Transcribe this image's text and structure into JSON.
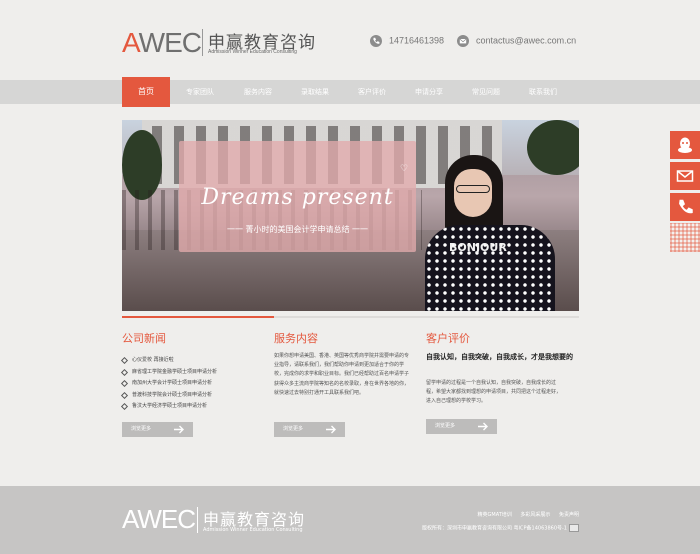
{
  "header": {
    "logo_text": "AWEC",
    "logo_first": "A",
    "logo_rest": "WEC",
    "logo_cn": "申赢教育咨询",
    "logo_en": "Admission Winner Education Consulting",
    "phone": "14716461398",
    "email": "contactus@awec.com.cn",
    "phone_icon": "phone-icon",
    "email_icon": "mail-icon"
  },
  "nav": {
    "items": [
      "首页",
      "专家团队",
      "服务内容",
      "录取结果",
      "客户评价",
      "申请分享",
      "常见问题",
      "联系我们"
    ],
    "active_index": 0
  },
  "banner": {
    "headline": "Dreams present",
    "subline": "一一 菁小时的美国会计学申请总结 一一",
    "shirt_text": "BONJOUR"
  },
  "news": {
    "title": "公司新闻",
    "items": [
      "心仪爱校 再接近啦",
      "麻省理工学院金融学硕士项目申请分析",
      "南加州大学会计学硕士项目申请分析",
      "普渡科技学院会计硕士项目申请分析",
      "鲁汶大学经济学硕士项目申请分析"
    ],
    "more": "浏览更多"
  },
  "services": {
    "title": "服务内容",
    "text": "如果你想申请美国、香港、英国等优秀商学院并需要申请的专业指导，请联系我们，我们帮助你申请到更加适合于你的学校，完成你的求学和职业目标。我们已经帮助过百名申请学子获得众多主流商学院等知名的名校录取，身在世界各地的你，就快速过去特别打通开工具联系我们吧。",
    "more": "浏览更多"
  },
  "reviews": {
    "title": "客户评价",
    "highlight": "自我认知，自我突破，自我成长，才是我想要的",
    "text": "留学申请的过程是一个自我认知，自我突破，自我成长的过程，希望大家都找到理想的申请项目，共同把这个过程走好，进入自己理想的学校学习。",
    "more": "浏览更多"
  },
  "footer": {
    "logo_text": "AWEC",
    "logo_cn": "申赢教育咨询",
    "logo_en": "Admission Winner Education Consulting",
    "links": [
      "精英GMAT培训",
      "多彩风采展示",
      "免责声明"
    ],
    "copyright": "版权所有：深圳市申赢教育咨询有限公司 粤ICP备14063860号-1"
  },
  "sidebar": {
    "icons": [
      "qq-icon",
      "mail-icon",
      "phone-icon",
      "qr-code-icon"
    ]
  },
  "colors": {
    "accent": "#e4583e",
    "nav_bar": "#d6d6d5",
    "footer": "#c6c5c4",
    "background": "#efeeec"
  }
}
